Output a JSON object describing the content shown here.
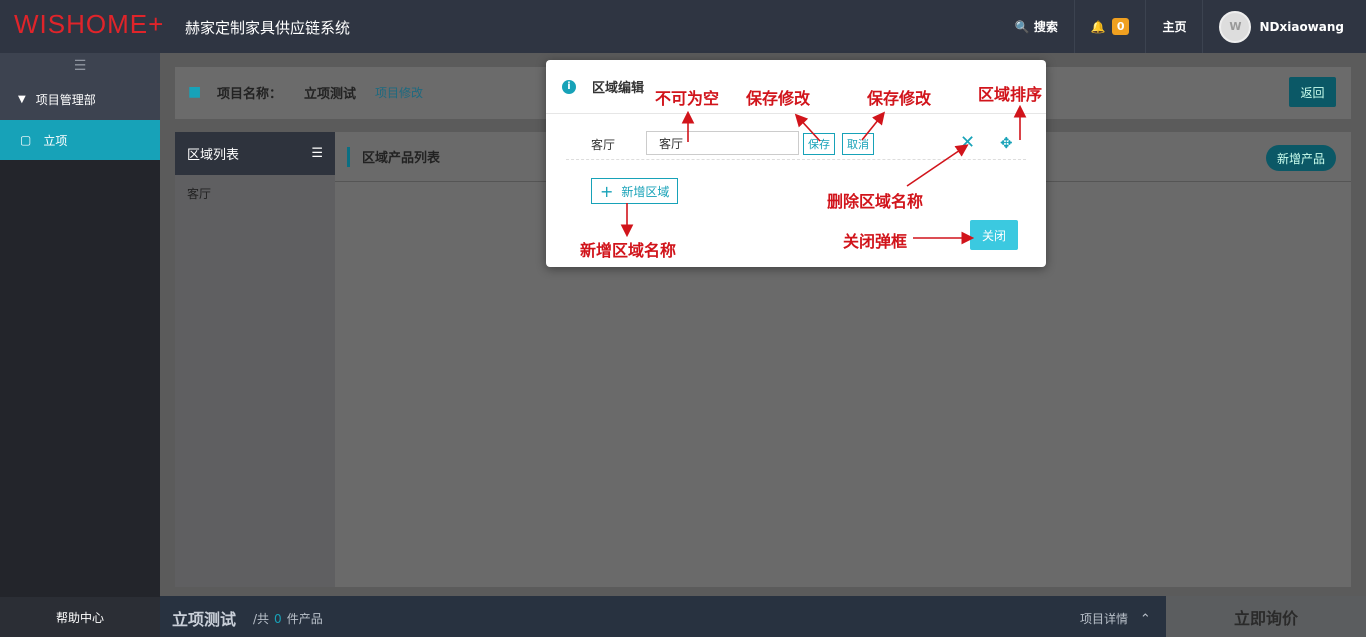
{
  "header": {
    "logo": "WISHOME+",
    "title": "赫家定制家具供应链系统",
    "search_label": "搜索",
    "notification_count": "0",
    "home_label": "主页",
    "username": "NDxiaowang"
  },
  "sidebar": {
    "group_label": "项目管理部",
    "active_item": "立项",
    "help_label": "帮助中心"
  },
  "project": {
    "name_label": "项目名称：",
    "name_value": "立项测试",
    "edit_link": "项目修改",
    "back_label": "返回"
  },
  "area_list": {
    "title": "区域列表",
    "items": [
      "客厅"
    ]
  },
  "product_list": {
    "title": "区域产品列表",
    "add_label": "新增产品"
  },
  "bottom": {
    "project_name": "立项测试",
    "count_prefix": "/共",
    "count": "0",
    "count_suffix": "件产品",
    "detail_label": "项目详情",
    "inquiry_label": "立即询价"
  },
  "modal": {
    "title": "区域编辑",
    "row_label": "客厅",
    "row_value": "客厅",
    "save_label": "保存",
    "cancel_label": "取消",
    "add_area_label": "新增区域",
    "close_label": "关闭"
  },
  "annotations": {
    "not_empty": "不可为空",
    "save_edit_1": "保存修改",
    "save_edit_2": "保存修改",
    "sort_area": "区域排序",
    "delete_area": "删除区域名称",
    "add_area": "新增区域名称",
    "close_dialog": "关闭弹框"
  },
  "colors": {
    "accent": "#17a2b8",
    "annotation": "#d1141b",
    "topbar": "#2f3542"
  }
}
